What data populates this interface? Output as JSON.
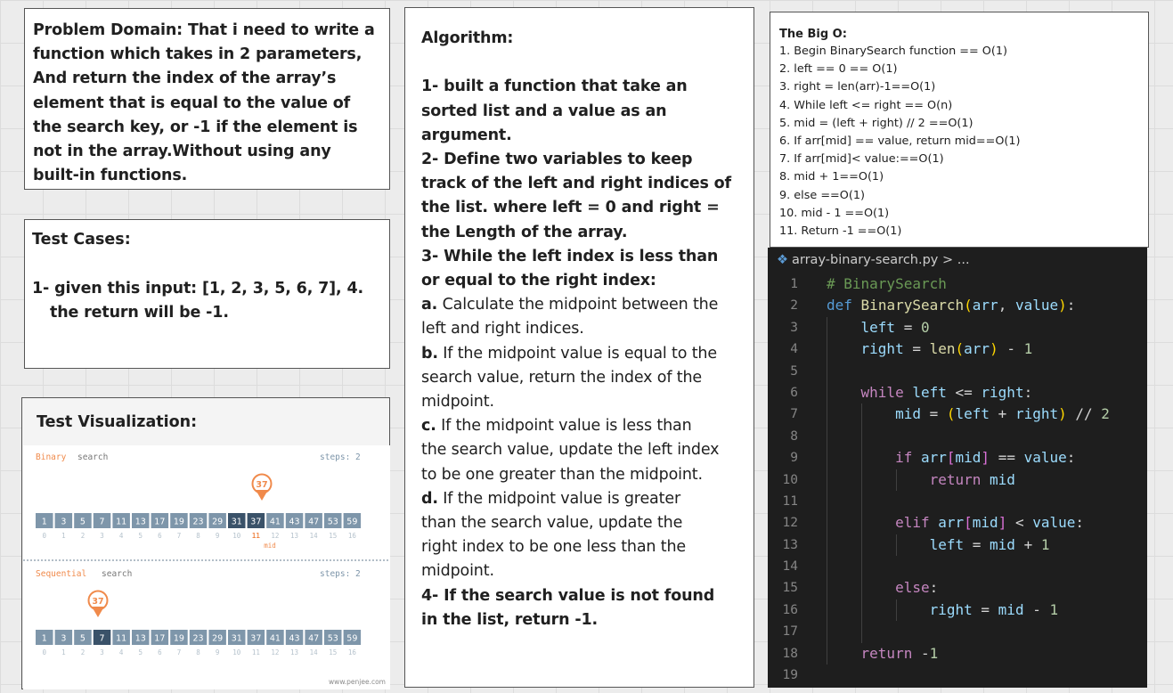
{
  "problem": {
    "lines": [
      "Problem Domain: That i need to write a",
      "function which takes in 2 parameters,",
      "And return the index of the array’s",
      "element that is equal to the value of",
      "the search key, or -1 if the element is",
      "not in the array.Without using any",
      "built-in functions."
    ]
  },
  "tests": {
    "title": "Test Cases:",
    "line1": "1- given this input: [1, 2, 3, 5, 6, 7], 4.",
    "line2": "the return will be  -1."
  },
  "viz": {
    "title": "Test Visualization:",
    "binary_label_a": "Binary",
    "binary_label_b": "search",
    "sequential_label_a": "Sequential",
    "sequential_label_b": "search",
    "steps_text": "steps: 2",
    "mid_label": "mid",
    "watermark": "www.penjee.com",
    "values": [
      1,
      3,
      5,
      7,
      11,
      13,
      17,
      19,
      23,
      29,
      31,
      37,
      41,
      43,
      47,
      53,
      59
    ],
    "indices": [
      0,
      1,
      2,
      3,
      4,
      5,
      6,
      7,
      8,
      9,
      10,
      11,
      12,
      13,
      14,
      15,
      16
    ],
    "target": "37",
    "binary_dark_indices": [
      10,
      11
    ],
    "sequential_dark_indices": [
      3
    ]
  },
  "algorithm": {
    "rows": [
      {
        "bold": "Algorithm:",
        "normal": ""
      },
      {
        "bold": "",
        "normal": ""
      },
      {
        "bold": "1- built a function that take an",
        "normal": ""
      },
      {
        "bold": "sorted list and a value as an",
        "normal": ""
      },
      {
        "bold": "argument.",
        "normal": ""
      },
      {
        "bold": "2- Define two variables to keep",
        "normal": ""
      },
      {
        "bold": "track of the left and right indices of",
        "normal": ""
      },
      {
        "bold": "the list. where left = 0 and right =",
        "normal": ""
      },
      {
        "bold": "the Length of the array.",
        "normal": ""
      },
      {
        "bold": "3- While the left index is less than",
        "normal": ""
      },
      {
        "bold": "or equal to the right index:",
        "normal": ""
      },
      {
        "bold": "a.",
        "normal": " Calculate the midpoint between the"
      },
      {
        "bold": "",
        "normal": "left and right indices."
      },
      {
        "bold": "b.",
        "normal": " If the midpoint value is equal to the"
      },
      {
        "bold": "",
        "normal": "search value, return the index of the"
      },
      {
        "bold": "",
        "normal": "midpoint."
      },
      {
        "bold": "c.",
        "normal": " If the midpoint value is less than"
      },
      {
        "bold": "",
        "normal": "the search value, update the left index"
      },
      {
        "bold": "",
        "normal": "to be one greater than the midpoint."
      },
      {
        "bold": "d.",
        "normal": " If the midpoint value is greater"
      },
      {
        "bold": "",
        "normal": "than the search value, update the"
      },
      {
        "bold": "",
        "normal": "right index to be one less than the"
      },
      {
        "bold": "",
        "normal": "midpoint."
      },
      {
        "bold": "4- If the search value is not found",
        "normal": ""
      },
      {
        "bold": "in the list, return -1.",
        "normal": ""
      }
    ]
  },
  "bigo": {
    "title": "The Big O:",
    "lines": [
      "1. Begin BinarySearch function == O(1)",
      "2. left == 0 == O(1)",
      "3. right = len(arr)-1==O(1)",
      "4. While left <= right == O(n)",
      "5.  mid = (left + right) // 2 ==O(1)",
      "6. If arr[mid] == value, return mid==O(1)",
      "7. If arr[mid]< value:==O(1)",
      "8. mid + 1==O(1)",
      "9. else ==O(1)",
      "10. mid - 1 ==O(1)",
      "11. Return -1  ==O(1)"
    ]
  },
  "editor": {
    "breadcrumb": "array-binary-search.py",
    "breadcrumb_tail": "> ...",
    "line_numbers": [
      "1",
      "2",
      "3",
      "4",
      "5",
      "6",
      "7",
      "8",
      "9",
      "10",
      "11",
      "12",
      "13",
      "14",
      "15",
      "16",
      "17",
      "18",
      "19"
    ],
    "code": [
      "# BinarySearch",
      "def BinarySearch(arr, value):",
      "    left = 0",
      "    right = len(arr) - 1",
      "",
      "    while left <= right:",
      "        mid = (left + right) // 2",
      "",
      "        if arr[mid] == value:",
      "            return mid",
      "",
      "        elif arr[mid] < value:",
      "            left = mid + 1",
      "",
      "        else:",
      "            right = mid - 1",
      "",
      "    return -1",
      ""
    ]
  },
  "colors": {
    "accent_orange": "#f08a4b",
    "cell_light": "#7e96aa",
    "cell_dark": "#3a5269",
    "editor_bg": "#1e1e1e"
  }
}
